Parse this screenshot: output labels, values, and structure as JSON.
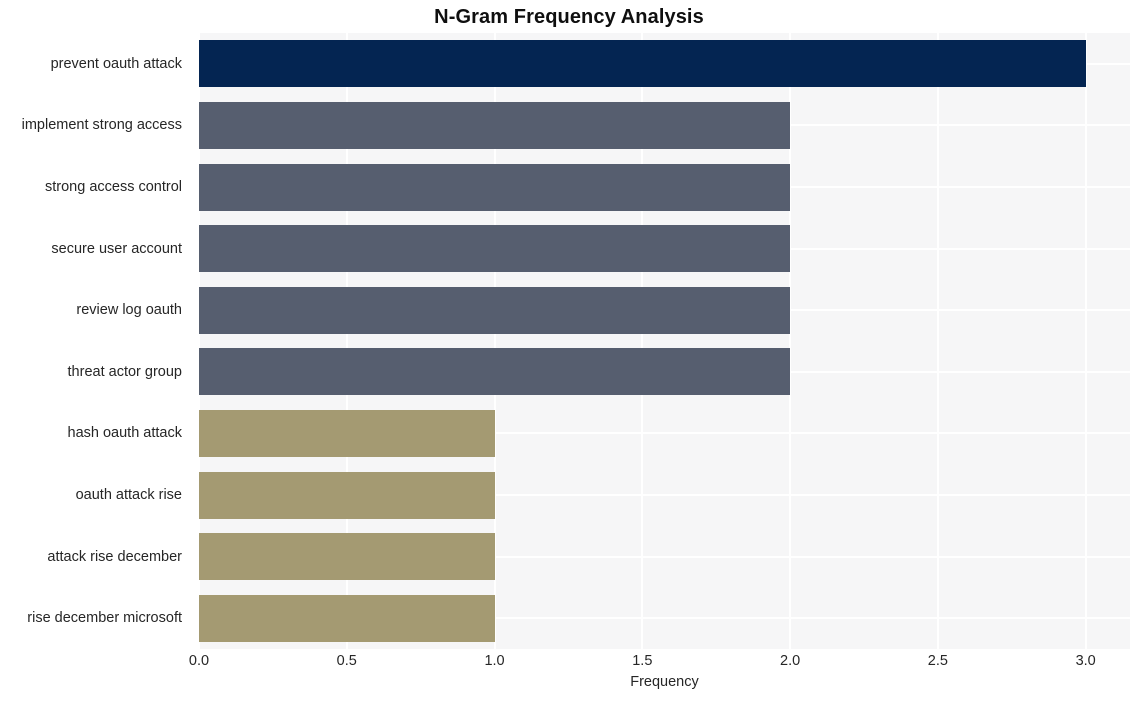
{
  "chart_data": {
    "type": "bar",
    "orientation": "horizontal",
    "title": "N-Gram Frequency Analysis",
    "xlabel": "Frequency",
    "ylabel": "",
    "categories": [
      "prevent oauth attack",
      "implement strong access",
      "strong access control",
      "secure user account",
      "review log oauth",
      "threat actor group",
      "hash oauth attack",
      "oauth attack rise",
      "attack rise december",
      "rise december microsoft"
    ],
    "values": [
      3,
      2,
      2,
      2,
      2,
      2,
      1,
      1,
      1,
      1
    ],
    "bar_colors": [
      "#042552",
      "#565e6f",
      "#565e6f",
      "#565e6f",
      "#565e6f",
      "#565e6f",
      "#a49a72",
      "#a49a72",
      "#a49a72",
      "#a49a72"
    ],
    "xlim": [
      0,
      3.15
    ],
    "xticks": [
      0.0,
      0.5,
      1.0,
      1.5,
      2.0,
      2.5,
      3.0
    ],
    "xtick_labels": [
      "0.0",
      "0.5",
      "1.0",
      "1.5",
      "2.0",
      "2.5",
      "3.0"
    ],
    "grid": true,
    "grid_color": "#ffffff",
    "plot_background": "#f6f6f7",
    "figure_background": "#ffffff",
    "legend": null
  }
}
